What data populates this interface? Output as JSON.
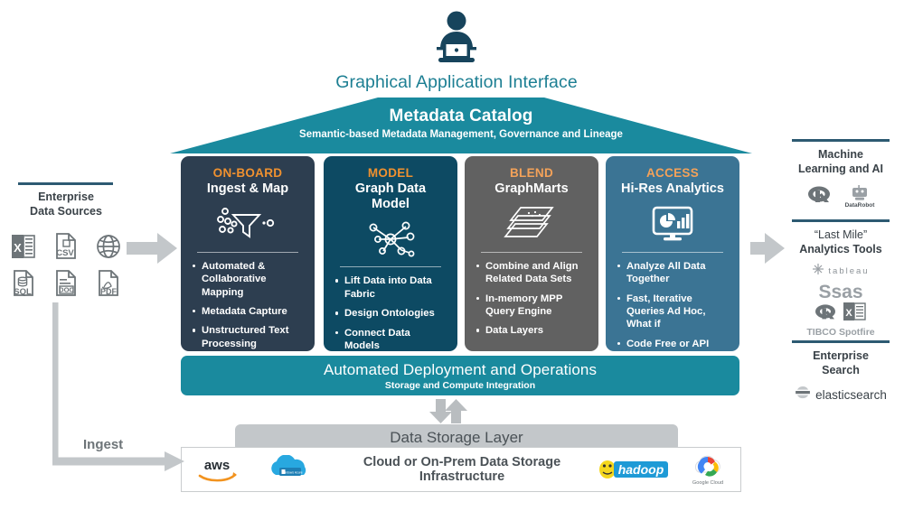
{
  "top": {
    "icon": "person-at-laptop-icon",
    "title": "Graphical Application Interface"
  },
  "roof": {
    "title": "Metadata Catalog",
    "subtitle": "Semantic-based Metadata Management, Governance and Lineage",
    "color": "#1a8a9e"
  },
  "pillars": [
    {
      "id": "on-board",
      "kicker": "ON-BOARD",
      "title": "Ingest & Map",
      "icon": "funnel-icon",
      "color": "#2d3e50",
      "items": [
        "Automated & Collaborative Mapping",
        "Metadata Capture",
        "Unstructured Text Processing"
      ]
    },
    {
      "id": "model",
      "kicker": "MODEL",
      "title": "Graph Data Model",
      "icon": "graph-nodes-icon",
      "color": "#0d4a63",
      "items": [
        "Lift Data into Data Fabric",
        "Design Ontologies",
        "Connect Data Models"
      ]
    },
    {
      "id": "blend",
      "kicker": "BLEND",
      "title": "GraphMarts",
      "icon": "layers-icon",
      "color": "#616161",
      "items": [
        "Combine and Align Related Data Sets",
        "In-memory MPP Query Engine",
        "Data Layers"
      ]
    },
    {
      "id": "access",
      "kicker": "ACCESS",
      "title": "Hi-Res Analytics",
      "icon": "monitor-chart-icon",
      "color": "#3b7494",
      "items": [
        "Analyze All Data Together",
        "Fast, Iterative Queries Ad Hoc, What if",
        "Code Free or API"
      ]
    }
  ],
  "deploy": {
    "title": "Automated Deployment and Operations",
    "subtitle": "Storage and Compute Integration"
  },
  "storage_layer": {
    "label": "Data Storage Layer"
  },
  "infrastructure": {
    "label": "Cloud or On-Prem Data Storage Infrastructure",
    "logos_left": [
      "aws",
      "Windows Azure"
    ],
    "logos_right": [
      "hadoop",
      "Google Cloud"
    ]
  },
  "left": {
    "title": "Enterprise\nData Sources",
    "title_line1": "Enterprise",
    "title_line2": "Data Sources",
    "source_icons": [
      "excel-x-icon",
      "csv-file-icon",
      "globe-icon",
      "sql-database-icon",
      "doc-file-icon",
      "pdf-file-icon"
    ],
    "ingest_label": "Ingest",
    "arrow": "right-arrow-icon"
  },
  "right": {
    "sections": [
      {
        "title_line1": "Machine",
        "title_line2": "Learning and AI",
        "logos": [
          "R",
          "DataRobot"
        ]
      },
      {
        "title_line1": "“Last Mile”",
        "title_line2": "Analytics Tools",
        "logos": [
          "tableau",
          "SAS",
          "R",
          "Excel",
          "TIBCO Spotfire"
        ]
      },
      {
        "title_line1": "Enterprise",
        "title_line2": "Search",
        "logos": [
          "elasticsearch"
        ]
      }
    ],
    "arrow": "right-arrow-icon"
  },
  "colors": {
    "teal": "#1a8a9e",
    "orange": "#f0912f",
    "navy": "#2d3e50",
    "gray": "#c3c7ca",
    "rule_blue": "#2d5a72"
  }
}
